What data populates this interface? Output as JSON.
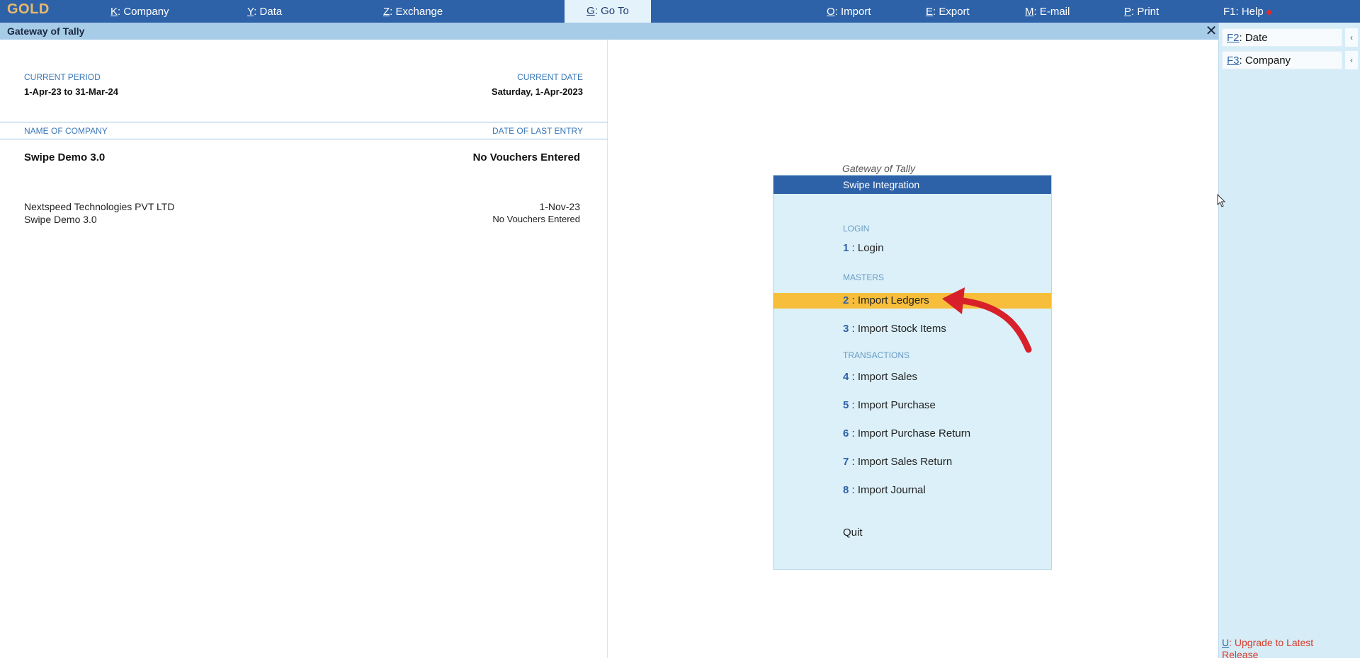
{
  "topbar": {
    "brand": "GOLD",
    "menus": [
      {
        "key": "K",
        "label": ": Company"
      },
      {
        "key": "Y",
        "label": ": Data"
      },
      {
        "key": "Z",
        "label": ": Exchange"
      },
      {
        "key": "G",
        "label": ": Go To"
      },
      {
        "key": "O",
        "label": ": Import"
      },
      {
        "key": "E",
        "label": ": Export"
      },
      {
        "key": "M",
        "label": ": E-mail"
      },
      {
        "key": "P",
        "label": ": Print"
      },
      {
        "key": "F1",
        "label": ": Help"
      }
    ]
  },
  "titlebar": {
    "title": "Gateway of Tally",
    "close": "✕"
  },
  "left": {
    "current_period_label": "CURRENT PERIOD",
    "current_period_value": "1-Apr-23 to 31-Mar-24",
    "current_date_label": "CURRENT DATE",
    "current_date_value": "Saturday, 1-Apr-2023",
    "name_col": "NAME OF COMPANY",
    "date_col": "DATE OF LAST ENTRY",
    "companies": [
      {
        "name": "Swipe Demo 3.0",
        "date": "No Vouchers Entered"
      },
      {
        "name": "Nextspeed Technologies PVT LTD",
        "date": "1-Nov-23"
      },
      {
        "name": "Swipe Demo 3.0",
        "date": "No Vouchers Entered"
      }
    ]
  },
  "right": {
    "buttons": [
      {
        "key": "F2",
        "label": ": Date",
        "chev": "‹"
      },
      {
        "key": "F3",
        "label": ": Company",
        "chev": "‹"
      }
    ],
    "upgrade_key": "U",
    "upgrade_label": ": Upgrade to Latest Release"
  },
  "popup": {
    "heading": "Gateway of Tally",
    "title": "Swipe Integration",
    "sections": {
      "login": "LOGIN",
      "masters": "MASTERS",
      "transactions": "TRANSACTIONS"
    },
    "items": [
      {
        "num": "1",
        "label": " : Login"
      },
      {
        "num": "2",
        "label": " : Import Ledgers"
      },
      {
        "num": "3",
        "label": " : Import Stock Items"
      },
      {
        "num": "4",
        "label": " : Import Sales"
      },
      {
        "num": "5",
        "label": " : Import Purchase"
      },
      {
        "num": "6",
        "label": " : Import Purchase Return"
      },
      {
        "num": "7",
        "label": " : Import Sales Return"
      },
      {
        "num": "8",
        "label": " : Import Journal"
      }
    ],
    "quit": "Quit"
  },
  "colors": {
    "brand_blue": "#2e62a8",
    "highlight": "#f7be3b",
    "annotation_arrow": "#d8202a"
  }
}
